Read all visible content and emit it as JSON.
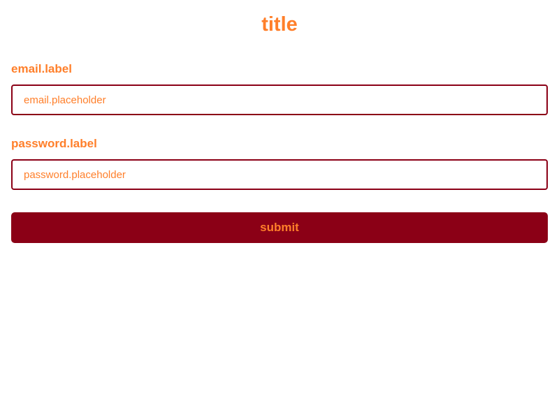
{
  "title": "title",
  "email": {
    "label": "email.label",
    "placeholder": "email.placeholder",
    "value": ""
  },
  "password": {
    "label": "password.label",
    "placeholder": "password.placeholder",
    "value": ""
  },
  "submit": {
    "label": "submit"
  },
  "colors": {
    "accent": "#ff7f2a",
    "brand": "#8b0016",
    "background": "#ffffff"
  }
}
